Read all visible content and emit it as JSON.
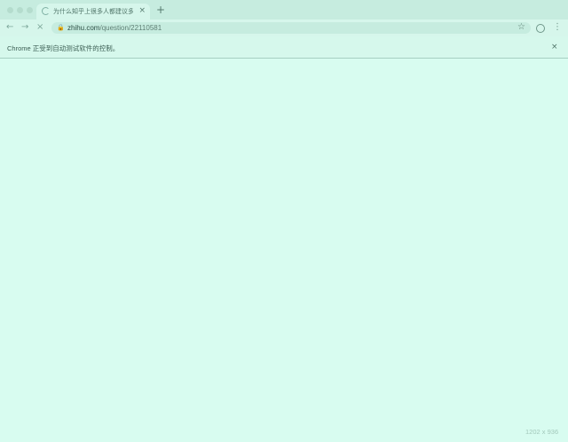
{
  "tab": {
    "title": "为什么知乎上很多人都建议多读",
    "close_glyph": "×",
    "new_tab_glyph": "+"
  },
  "toolbar": {
    "back_glyph": "←",
    "forward_glyph": "→",
    "stop_glyph": "×",
    "url_host": "zhihu.com",
    "url_path": "/question/22110581",
    "lock_glyph": "🔒",
    "star_glyph": "☆",
    "menu_glyph": "⋮"
  },
  "infobar": {
    "message": "Chrome 正受到自动测试软件的控制。",
    "close_glyph": "×"
  },
  "viewport": {
    "size_readout": "1202 x 936"
  },
  "icons": [
    "loading-spinner-icon",
    "close-icon",
    "plus-icon",
    "back-arrow-icon",
    "forward-arrow-icon",
    "stop-icon",
    "lock-icon",
    "star-icon",
    "profile-icon",
    "more-vert-icon"
  ]
}
